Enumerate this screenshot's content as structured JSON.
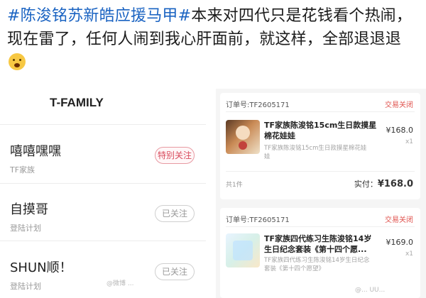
{
  "post": {
    "hashtags": "#陈浚铭苏新皓应援马甲#",
    "text": "本来对四代只是花钱看个热闹，现在雷了，任何人闹到我心肝面前，就这样，全部退退退"
  },
  "follow_list": {
    "title": "T-FAMILY",
    "items": [
      {
        "name": "嘻嘻嘿嘿",
        "sub": "TF家族",
        "button": "特别关注"
      },
      {
        "name": "自摸哥",
        "sub": "登陆计划",
        "button": "已关注"
      },
      {
        "name": "SHUN顺！",
        "sub": "登陆计划",
        "button": "已关注"
      }
    ]
  },
  "orders": [
    {
      "order_no": "订单号:TF2605171",
      "status": "交易关闭",
      "title": "TF家族陈浚铭15cm生日款摸星棉花娃娃",
      "spec": "TF家族陈浚铭15cm生日款摸星棉花娃娃",
      "price": "¥168.0",
      "qty": "x1",
      "count": "共1件",
      "paid_label": "实付：",
      "paid": "¥168.0"
    },
    {
      "order_no": "订单号:TF2605171",
      "status": "交易关闭",
      "title": "TF家族四代练习生陈浚铭14岁生日纪念套装《第十四个愿...",
      "spec": "TF家族四代练习生陈浚铭14岁生日纪念套装《第十四个愿望》",
      "price": "¥169.0",
      "qty": "x1"
    }
  ],
  "watermarks": {
    "center": "@微博 ...",
    "corner": "@... UU..."
  }
}
